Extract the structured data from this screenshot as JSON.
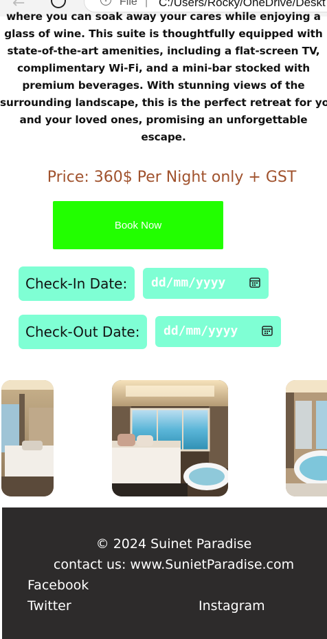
{
  "browser": {
    "back_icon": "arrow-left",
    "file_label": "File",
    "separator": "|",
    "url": "C:/Users/Rocky/OneDrive/Deskt"
  },
  "description_lines": [
    "where you can soak away your cares while enjoying a",
    "glass of wine. This suite is thoughtfully equipped with",
    "state-of-the-art amenities, including a flat-screen TV,",
    "complimentary Wi-Fi, and a mini-bar stocked with",
    "premium beverages. With stunning views of the",
    "surrounding landscape, this is the perfect retreat for you",
    "and your loved ones, promising an unforgettable",
    "escape."
  ],
  "price": "Price: 360$ Per Night only + GST",
  "booking": {
    "book_label": "Book Now",
    "checkin_label": "Check-In Date:",
    "checkout_label": "Check-Out Date:",
    "date_placeholder": "dd/mm/yyyy"
  },
  "footer": {
    "copyright": "© 2024 Suinet Paradise",
    "contact": "contact us: www.SunietParadise.com",
    "links": {
      "facebook": "Facebook",
      "twitter": "Twitter",
      "instagram": "Instagram"
    }
  },
  "colors": {
    "price": "#a0522d",
    "book_button": "#22ff00",
    "date_fields": "#7fffd4",
    "footer_bg": "#2d2b2b"
  }
}
